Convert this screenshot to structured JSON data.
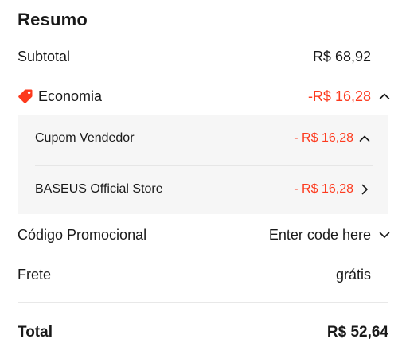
{
  "summary": {
    "title": "Resumo",
    "subtotal": {
      "label": "Subtotal",
      "value": "R$ 68,92"
    },
    "economia": {
      "label": "Economia",
      "value": "-R$ 16,28",
      "icon": "tag-icon",
      "expanded": true
    },
    "discounts": [
      {
        "label": "Cupom Vendedor",
        "value": "- R$ 16,28",
        "chevron": "chevron-up-icon"
      },
      {
        "label": "BASEUS Official Store",
        "value": "- R$ 16,28",
        "chevron": "chevron-right-icon"
      }
    ],
    "promo_code": {
      "label": "Código Promocional",
      "placeholder": "Enter code here",
      "chevron": "chevron-down-icon"
    },
    "shipping": {
      "label": "Frete",
      "value": "grátis"
    },
    "total": {
      "label": "Total",
      "value": "R$ 52,64"
    }
  },
  "colors": {
    "accent_red": "#fd3a1e",
    "text": "#191919",
    "detail_bg": "#f6f6f6"
  }
}
